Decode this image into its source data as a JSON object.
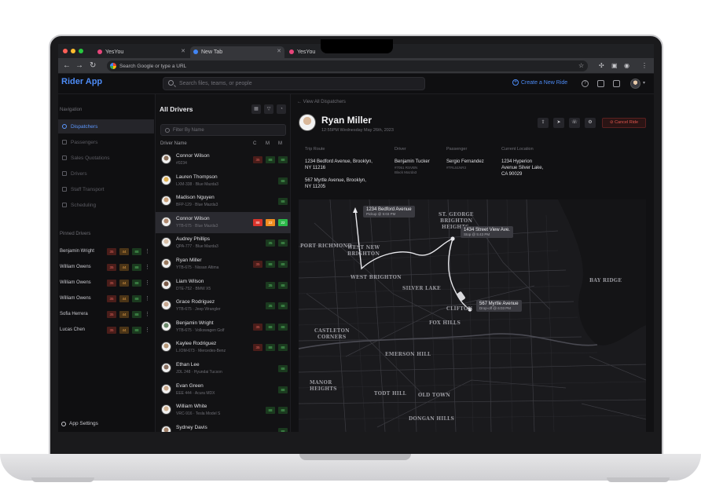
{
  "browser": {
    "tabs": [
      {
        "title": "YesYou",
        "color": "#e8457a"
      },
      {
        "title": "New Tab",
        "color": "#4285f4"
      },
      {
        "title": "YesYou",
        "color": "#e8457a"
      }
    ],
    "omnibox_placeholder": "Search Google or type a URL"
  },
  "app": {
    "logo": "Rider App",
    "search_placeholder": "Search files, teams, or people",
    "create_ride": "Create a New Ride"
  },
  "nav": {
    "heading": "Navigation",
    "items": [
      {
        "label": "Dispatchers",
        "active": true
      },
      {
        "label": "Passengers"
      },
      {
        "label": "Sales Quotations"
      },
      {
        "label": "Drivers"
      },
      {
        "label": "Staff Transport"
      },
      {
        "label": "Scheduling"
      }
    ],
    "pinned_heading": "Pinned Drivers",
    "pinned": [
      {
        "name": "Benjamin Wright",
        "c": "35",
        "m": "44",
        "m2": "88"
      },
      {
        "name": "William Owens",
        "c": "35",
        "m": "44",
        "m2": "88"
      },
      {
        "name": "William Owens",
        "c": "35",
        "m": "44",
        "m2": "88"
      },
      {
        "name": "William Owens",
        "c": "35",
        "m": "44",
        "m2": "88"
      },
      {
        "name": "Sofia Herrera",
        "c": "35",
        "m": "44",
        "m2": "88"
      },
      {
        "name": "Lucas Chen",
        "c": "35",
        "m": "44",
        "m2": "88"
      }
    ],
    "settings": "App Settings"
  },
  "drivers": {
    "title": "All Drivers",
    "filter_placeholder": "Filter By Name",
    "col_name": "Driver Name",
    "col_c": "C",
    "col_m1": "M",
    "col_m2": "M",
    "rows": [
      {
        "name": "Connor Wilson",
        "sub": "#0234",
        "badges": [
          "35",
          "88",
          "88"
        ]
      },
      {
        "name": "Lauren Thompson",
        "sub": "LXM-338 · Blue Mazda3",
        "badges": [
          "88"
        ]
      },
      {
        "name": "Madison Nguyen",
        "sub": "BFP-129 · Blue Mazda3",
        "badges": [
          "88"
        ]
      },
      {
        "name": "Connor Wilson",
        "sub": "YTB-675 · Blue Mazda3",
        "badges": [
          "88",
          "22",
          "22"
        ],
        "selected": true
      },
      {
        "name": "Audrey Phillips",
        "sub": "QPA-777 · Blue Mazda3",
        "badges": [
          "35",
          "88"
        ]
      },
      {
        "name": "Ryan Miller",
        "sub": "YTB-675 · Nissan Altima",
        "badges": [
          "35",
          "88",
          "88"
        ]
      },
      {
        "name": "Liam Wilson",
        "sub": "DTE-752 · BMW X5",
        "badges": [
          "35",
          "88"
        ]
      },
      {
        "name": "Grace Rodriguez",
        "sub": "YTB-675 · Jeep Wrangler",
        "badges": [
          "35",
          "88"
        ]
      },
      {
        "name": "Benjamin Wright",
        "sub": "YTB-675 · Volkswagen Golf",
        "badges": [
          "35",
          "88",
          "88"
        ]
      },
      {
        "name": "Kaylee Rodriguez",
        "sub": "L.IOM-673 · Mercedes-Benz",
        "badges": [
          "35",
          "88",
          "88"
        ]
      },
      {
        "name": "Ethan Lee",
        "sub": "JDL 248 · Hyundai Tucson",
        "badges": [
          "88"
        ]
      },
      {
        "name": "Evan Green",
        "sub": "EEE 444 · Acura MDX",
        "badges": [
          "88"
        ]
      },
      {
        "name": "William White",
        "sub": "VRC-916 · Tesla Model S",
        "badges": [
          "88",
          "88"
        ]
      },
      {
        "name": "Sydney Davis",
        "sub": "YTB-675 · Acura MDX",
        "badges": [
          "88"
        ]
      }
    ]
  },
  "ride": {
    "back": "View All Dispatchers",
    "rider_name": "Ryan Miller",
    "rider_time": "12:55PM Wednesday May 26th, 2023",
    "cancel": "Cancel Ride",
    "trip_label": "Trip Route",
    "trip_line1": "1234 Bedford Avenue, Brooklyn,",
    "trip_line2": "NY 11216",
    "trip_line3": "567 Myrtle Avenue, Brooklyn,",
    "trip_line4": "NY 11205",
    "driver_label": "Driver",
    "driver_name": "Benjamin Tucker",
    "driver_sub1": "#7051 RSVBN",
    "driver_sub2": "Black Mazda3",
    "passenger_label": "Passenger",
    "passenger_name": "Sergio Fernandez",
    "passenger_sub": "#TRL51NR3",
    "location_label": "Current Location",
    "location_line1": "1234 Hyperion",
    "location_line2": "Avenue Silver Lake,",
    "location_line3": "CA 90029"
  },
  "map": {
    "labels": [
      "ST. GEORGE",
      "BRIGHTON",
      "HEIGHTS",
      "PORT RICHMOND",
      "WEST NEW",
      "BRIGHTON",
      "WEST BRIGHTON",
      "SILVER LAKE",
      "CLIFTON",
      "FOX HILLS",
      "CASTLETON",
      "CORNERS",
      "EMERSON HILL",
      "BAY RIDGE",
      "MANOR",
      "HEIGHTS",
      "TODT HILL",
      "OLD TOWN",
      "DONGAN HILLS"
    ],
    "callouts": [
      {
        "title": "1234 Bedford Avenue",
        "sub": "Pickup @ 5:03 PM"
      },
      {
        "title": "1434 Street View Ave.",
        "sub": "Stop @ 5:43 PM"
      },
      {
        "title": "567 Myrtle Avenue",
        "sub": "Drop-off @ 6:03 PM"
      }
    ]
  },
  "colors": {
    "accent": "#4d8bf5",
    "danger": "#e0554d",
    "success": "#2cb94a",
    "warning": "#f08d1f"
  }
}
